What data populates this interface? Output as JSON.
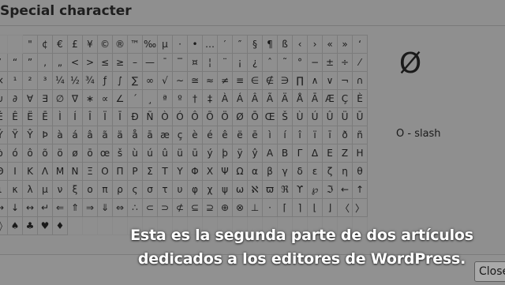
{
  "dialog": {
    "title": "Special character",
    "close_label": "Close"
  },
  "preview": {
    "glyph": "Ø",
    "name": "O - slash"
  },
  "grid": {
    "rows": [
      [
        "",
        "",
        "\"",
        "¢",
        "€",
        "£",
        "¥",
        "©",
        "®",
        "™",
        "‰",
        "µ",
        "·",
        "•",
        "…",
        "′",
        "″",
        "§",
        "¶",
        "ß",
        "‹",
        "›",
        "«",
        "»",
        "‘"
      ],
      [
        "’",
        "“",
        "”",
        "‚",
        "„",
        "<",
        ">",
        "≤",
        "≥",
        "–",
        "—",
        "¯",
        "‾",
        "¤",
        "¦",
        "¨",
        "¡",
        "¿",
        "ˆ",
        "˜",
        "°",
        "−",
        "±",
        "÷",
        "⁄"
      ],
      [
        "×",
        "¹",
        "²",
        "³",
        "¼",
        "½",
        "¾",
        "ƒ",
        "∫",
        "∑",
        "∞",
        "√",
        "∼",
        "≅",
        "≈",
        "≠",
        "≡",
        "∈",
        "∉",
        "∋",
        "∏",
        "∧",
        "∨",
        "¬",
        "∩"
      ],
      [
        "∪",
        "∂",
        "∀",
        "∃",
        "∅",
        "∇",
        "∗",
        "∝",
        "∠",
        "´",
        "¸",
        "ª",
        "º",
        "†",
        "‡",
        "À",
        "Á",
        "Â",
        "Ã",
        "Ä",
        "Å",
        "Ā",
        "Æ",
        "Ç",
        "È"
      ],
      [
        "É",
        "Ê",
        "Ë",
        "Ē",
        "Ì",
        "Í",
        "Î",
        "Ï",
        "Ī",
        "Ð",
        "Ñ",
        "Ò",
        "Ó",
        "Ô",
        "Õ",
        "Ö",
        "Ø",
        "Ō",
        "Œ",
        "Š",
        "Ù",
        "Ú",
        "Û",
        "Ü",
        "Ū"
      ],
      [
        "Ý",
        "Ÿ",
        "Ŷ",
        "Þ",
        "à",
        "á",
        "â",
        "ã",
        "ä",
        "å",
        "ā",
        "æ",
        "ç",
        "è",
        "é",
        "ê",
        "ë",
        "ē",
        "ì",
        "í",
        "î",
        "ï",
        "ī",
        "ð",
        "ñ"
      ],
      [
        "ò",
        "ó",
        "ô",
        "õ",
        "ö",
        "ø",
        "ō",
        "œ",
        "š",
        "ù",
        "ú",
        "û",
        "ü",
        "ū",
        "ý",
        "þ",
        "ÿ",
        "ŷ",
        "Α",
        "Β",
        "Γ",
        "Δ",
        "Ε",
        "Ζ",
        "Η"
      ],
      [
        "Θ",
        "Ι",
        "Κ",
        "Λ",
        "Μ",
        "Ν",
        "Ξ",
        "Ο",
        "Π",
        "Ρ",
        "Σ",
        "Τ",
        "Υ",
        "Φ",
        "Χ",
        "Ψ",
        "Ω",
        "α",
        "β",
        "γ",
        "δ",
        "ε",
        "ζ",
        "η",
        "θ"
      ],
      [
        "ι",
        "κ",
        "λ",
        "μ",
        "ν",
        "ξ",
        "ο",
        "π",
        "ρ",
        "ς",
        "σ",
        "τ",
        "υ",
        "φ",
        "χ",
        "ψ",
        "ω",
        "ℵ",
        "ϖ",
        "ℜ",
        "ϒ",
        "℘",
        "ℑ",
        "←",
        "↑"
      ],
      [
        "→",
        "↓",
        "↔",
        "↵",
        "⇐",
        "⇑",
        "⇒",
        "⇓",
        "⇔",
        "∴",
        "⊂",
        "⊃",
        "⊄",
        "⊆",
        "⊇",
        "⊕",
        "⊗",
        "⊥",
        "⋅",
        "⌈",
        "⌉",
        "⌊",
        "⌋",
        "〈",
        "〉"
      ],
      [
        "◊",
        "♠",
        "♣",
        "♥",
        "♦",
        "",
        "",
        "",
        "",
        "",
        "",
        "",
        "",
        "",
        "",
        "",
        "",
        "",
        "",
        "",
        "",
        "",
        "",
        "",
        ""
      ]
    ]
  },
  "caption": {
    "line1": "Esta es la segunda parte de dos artículos",
    "line2": "dedicados a los editores de WordPress."
  }
}
